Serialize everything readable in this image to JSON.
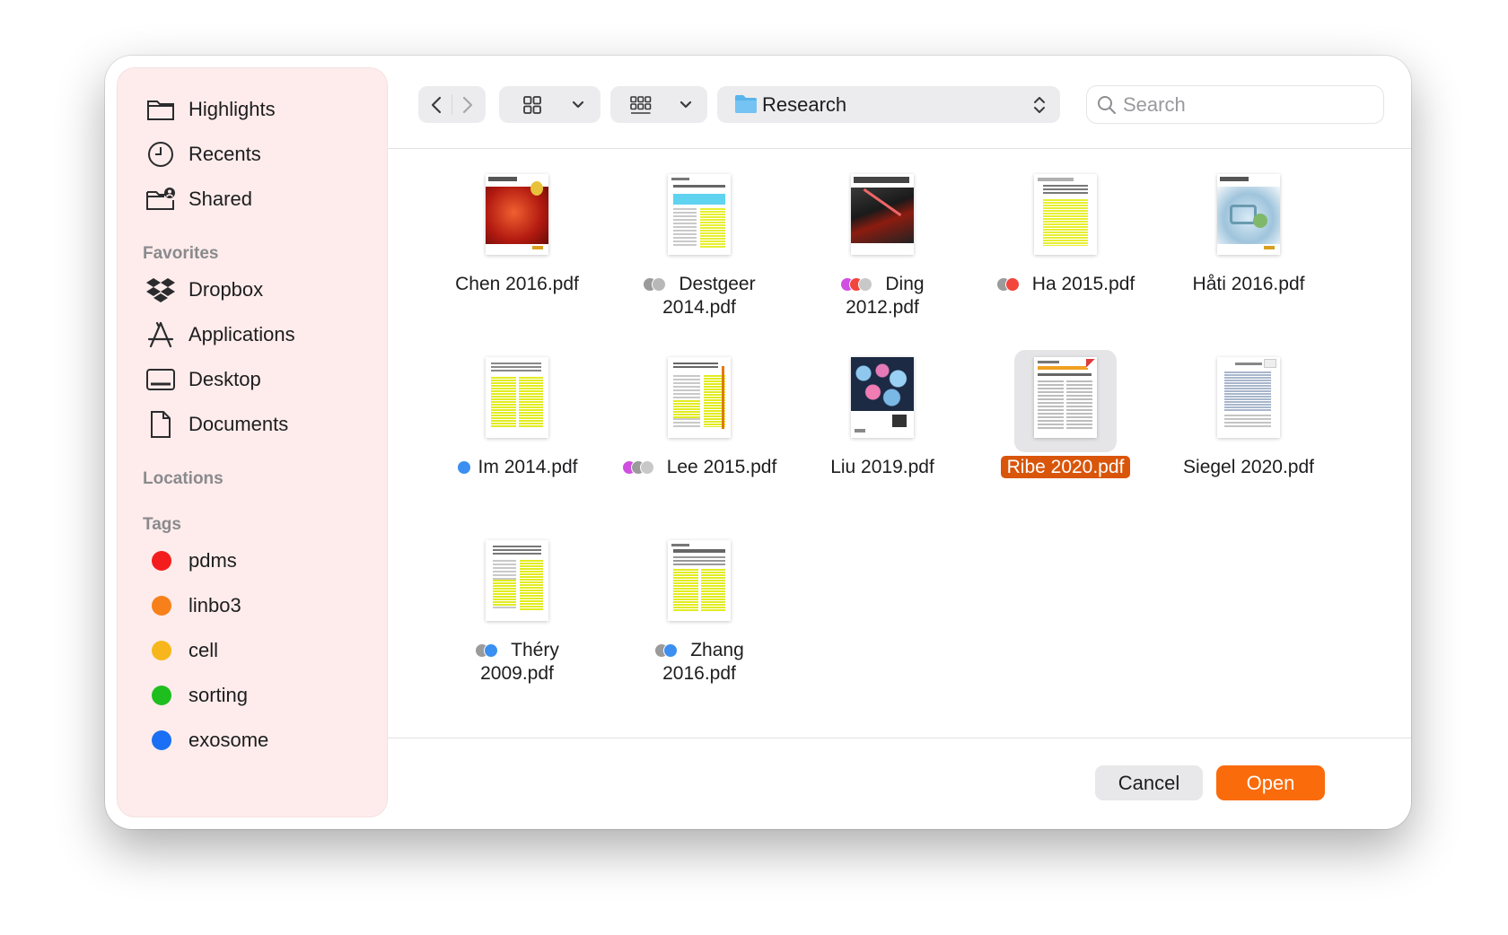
{
  "sidebar": {
    "top_items": [
      {
        "label": "Highlights",
        "icon": "folder-icon"
      },
      {
        "label": "Recents",
        "icon": "clock-icon"
      },
      {
        "label": "Shared",
        "icon": "shared-folder-icon"
      }
    ],
    "favorites_header": "Favorites",
    "favorites": [
      {
        "label": "Dropbox",
        "icon": "dropbox-icon"
      },
      {
        "label": "Applications",
        "icon": "applications-icon"
      },
      {
        "label": "Desktop",
        "icon": "desktop-icon"
      },
      {
        "label": "Documents",
        "icon": "document-icon"
      }
    ],
    "locations_header": "Locations",
    "tags_header": "Tags",
    "tags": [
      {
        "label": "pdms",
        "color": "#f41d1d"
      },
      {
        "label": "linbo3",
        "color": "#f8801a"
      },
      {
        "label": "cell",
        "color": "#f7b71c"
      },
      {
        "label": "sorting",
        "color": "#1fbe1f"
      },
      {
        "label": "exosome",
        "color": "#1b6ff4"
      }
    ]
  },
  "toolbar": {
    "path": "Research",
    "search_placeholder": "Search"
  },
  "files": [
    {
      "name": "Chen 2016.pdf",
      "line1": "",
      "line2": "Chen 2016.pdf",
      "tags": []
    },
    {
      "name": "Destgeer 2014.pdf",
      "line1": "Destgeer",
      "line2": "2014.pdf",
      "tags": [
        "#9b9b9b",
        "#b8b8b8"
      ]
    },
    {
      "name": "Ding 2012.pdf",
      "line1": "Ding",
      "line2": "2012.pdf",
      "tags": [
        "#cf4fe0",
        "#f2453c",
        "#c8c8c8"
      ]
    },
    {
      "name": "Ha 2015.pdf",
      "line1": "",
      "line2": "Ha 2015.pdf",
      "tags": [
        "#9b9b9b",
        "#f2453c"
      ],
      "inline": true
    },
    {
      "name": "Håti 2016.pdf",
      "line1": "",
      "line2": "Håti 2016.pdf",
      "tags": []
    },
    {
      "name": "Im 2014.pdf",
      "line1": "",
      "line2": "Im 2014.pdf",
      "tags": [
        "#3b8ff0"
      ],
      "inline": true
    },
    {
      "name": "Lee 2015.pdf",
      "line1": "",
      "line2": "Lee 2015.pdf",
      "tags": [
        "#cf4fe0",
        "#9b9b9b",
        "#c8c8c8"
      ],
      "inline": true
    },
    {
      "name": "Liu 2019.pdf",
      "line1": "",
      "line2": "Liu 2019.pdf",
      "tags": []
    },
    {
      "name": "Ribe 2020.pdf",
      "line1": "",
      "line2": "Ribe 2020.pdf",
      "tags": [],
      "selected": true
    },
    {
      "name": "Siegel 2020.pdf",
      "line1": "",
      "line2": "Siegel 2020.pdf",
      "tags": []
    },
    {
      "name": "Théry 2009.pdf",
      "line1": "Théry",
      "line2": "2009.pdf",
      "tags": [
        "#9b9b9b",
        "#3b8ff0"
      ]
    },
    {
      "name": "Zhang 2016.pdf",
      "line1": "Zhang",
      "line2": "2016.pdf",
      "tags": [
        "#9b9b9b",
        "#3b8ff0"
      ]
    }
  ],
  "buttons": {
    "cancel": "Cancel",
    "open": "Open"
  },
  "colors": {
    "accent": "#fa6b0b",
    "selection": "#d9550a",
    "sidebar_bg": "#fdeceb"
  }
}
